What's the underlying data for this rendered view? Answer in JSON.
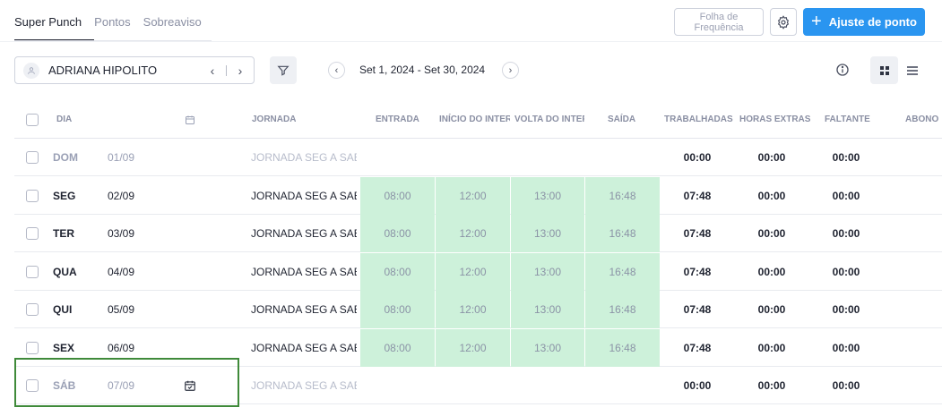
{
  "tabs": [
    {
      "label": "Super Punch",
      "active": true
    },
    {
      "label": "Pontos",
      "active": false
    },
    {
      "label": "Sobreaviso",
      "active": false
    }
  ],
  "header": {
    "folha_line1": "Folha de",
    "folha_line2": "Frequência",
    "settings_icon": "gear-icon",
    "ajuste_label": "Ajuste de ponto",
    "ajuste_plus": "+"
  },
  "toolbar": {
    "employee_name": "ADRIANA HIPOLITO",
    "date_range": "Set 1, 2024 - Set 30, 2024",
    "prev_glyph": "‹",
    "next_glyph": "›",
    "emp_prev_glyph": "‹",
    "emp_next_glyph": "›"
  },
  "table": {
    "columns": [
      "DIA",
      "JORNADA",
      "ENTRADA",
      "INÍCIO DO INTERVALO",
      "VOLTA DO INTERVALO",
      "SAÍDA",
      "TRABALHADAS",
      "HORAS EXTRAS",
      "FALTANTE",
      "ABONO"
    ],
    "rows": [
      {
        "day": "DOM",
        "date": "01/09",
        "jornada": "JORNADA SEG A SAB",
        "entrada": "",
        "inicio": "",
        "volta": "",
        "saida": "",
        "trabalhadas": "00:00",
        "extras": "00:00",
        "faltante": "00:00",
        "muted": true
      },
      {
        "day": "SEG",
        "date": "02/09",
        "jornada": "JORNADA SEG A SAB",
        "entrada": "08:00",
        "inicio": "12:00",
        "volta": "13:00",
        "saida": "16:48",
        "trabalhadas": "07:48",
        "extras": "00:00",
        "faltante": "00:00",
        "muted": false
      },
      {
        "day": "TER",
        "date": "03/09",
        "jornada": "JORNADA SEG A SAB",
        "entrada": "08:00",
        "inicio": "12:00",
        "volta": "13:00",
        "saida": "16:48",
        "trabalhadas": "07:48",
        "extras": "00:00",
        "faltante": "00:00",
        "muted": false
      },
      {
        "day": "QUA",
        "date": "04/09",
        "jornada": "JORNADA SEG A SAB",
        "entrada": "08:00",
        "inicio": "12:00",
        "volta": "13:00",
        "saida": "16:48",
        "trabalhadas": "07:48",
        "extras": "00:00",
        "faltante": "00:00",
        "muted": false
      },
      {
        "day": "QUI",
        "date": "05/09",
        "jornada": "JORNADA SEG A SAB",
        "entrada": "08:00",
        "inicio": "12:00",
        "volta": "13:00",
        "saida": "16:48",
        "trabalhadas": "07:48",
        "extras": "00:00",
        "faltante": "00:00",
        "muted": false
      },
      {
        "day": "SEX",
        "date": "06/09",
        "jornada": "JORNADA SEG A SAB",
        "entrada": "08:00",
        "inicio": "12:00",
        "volta": "13:00",
        "saida": "16:48",
        "trabalhadas": "07:48",
        "extras": "00:00",
        "faltante": "00:00",
        "muted": false
      },
      {
        "day": "SÁB",
        "date": "07/09",
        "jornada": "JORNADA SEG A SAB",
        "entrada": "",
        "inicio": "",
        "volta": "",
        "saida": "",
        "trabalhadas": "00:00",
        "extras": "00:00",
        "faltante": "00:00",
        "muted": true
      }
    ]
  },
  "colors": {
    "accent": "#2a95f0",
    "punch_cell_bg": "#cdf1da",
    "highlight_border": "#3f8a3a"
  }
}
